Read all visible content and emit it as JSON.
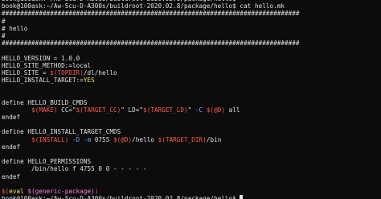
{
  "terminal": {
    "lines": [
      [
        {
          "t": "book@100ask:~/Aw-Scu-D-A300s/buildroot-2020.02.8/package/hello$",
          "c": "w"
        }
      ],
      [
        {
          "t": "book@100ask:~/Aw-Scu-D-A300s/buildroot-2020.02.8/package/hello$ cat hello.mk",
          "c": "w"
        }
      ],
      [
        {
          "t": "################################################################################",
          "c": "w"
        }
      ],
      [
        {
          "t": "#",
          "c": "w"
        }
      ],
      [
        {
          "t": "# hello",
          "c": "w"
        }
      ],
      [
        {
          "t": "#",
          "c": "w"
        }
      ],
      [
        {
          "t": "################################################################################",
          "c": "w"
        }
      ],
      [],
      [
        {
          "t": "HELLO_VERSION = 1.0.0",
          "c": "w"
        }
      ],
      [
        {
          "t": "HELLO_SITE_METHOD:=local",
          "c": "w"
        }
      ],
      [
        {
          "t": "HELLO_SITE = ",
          "c": "w"
        },
        {
          "t": "$(TOPDIR)",
          "c": "r"
        },
        {
          "t": "/dl/hello",
          "c": "w"
        }
      ],
      [
        {
          "t": "HELLO_INSTALL_TARGET:=",
          "c": "w"
        },
        {
          "t": "YES",
          "c": "y"
        }
      ],
      [],
      [],
      [
        {
          "t": "define HELLO_BUILD_CMDS",
          "c": "w"
        }
      ],
      [
        {
          "t": "        ",
          "c": "w"
        },
        {
          "t": "$(MAKE)",
          "c": "r"
        },
        {
          "t": " CC=\"",
          "c": "w"
        },
        {
          "t": "$(TARGET_CC)",
          "c": "r"
        },
        {
          "t": "\" LD=\"",
          "c": "w"
        },
        {
          "t": "$(TARGET_LD)",
          "c": "r"
        },
        {
          "t": "\" ",
          "c": "w"
        },
        {
          "t": "-C",
          "c": "b"
        },
        {
          "t": " ",
          "c": "w"
        },
        {
          "t": "$(@D)",
          "c": "r"
        },
        {
          "t": " all",
          "c": "w"
        }
      ],
      [
        {
          "t": "endef",
          "c": "w"
        }
      ],
      [],
      [
        {
          "t": "define HELLO_INSTALL_TARGET_CMDS",
          "c": "w"
        }
      ],
      [
        {
          "t": "        ",
          "c": "w"
        },
        {
          "t": "$(INSTALL)",
          "c": "r"
        },
        {
          "t": " ",
          "c": "w"
        },
        {
          "t": "-D",
          "c": "b"
        },
        {
          "t": " ",
          "c": "w"
        },
        {
          "t": "-m",
          "c": "b"
        },
        {
          "t": " 0755 ",
          "c": "w"
        },
        {
          "t": "$(@D)",
          "c": "r"
        },
        {
          "t": "/hello ",
          "c": "w"
        },
        {
          "t": "$(TARGET_DIR)",
          "c": "r"
        },
        {
          "t": "/bin",
          "c": "w"
        }
      ],
      [
        {
          "t": "endef",
          "c": "w"
        }
      ],
      [],
      [
        {
          "t": "define HELLO_PERMISSIONS",
          "c": "w"
        }
      ],
      [
        {
          "t": "        /bin/hello f 4755 0 0 - - - - -",
          "c": "w"
        }
      ],
      [
        {
          "t": "endef",
          "c": "w"
        }
      ],
      [],
      [
        {
          "t": "$(",
          "c": "r"
        },
        {
          "t": "eval",
          "c": "y"
        },
        {
          "t": " ",
          "c": "w"
        },
        {
          "t": "$(generic-package)",
          "c": "p"
        },
        {
          "t": ")",
          "c": "r"
        }
      ],
      [
        {
          "t": "book@100ask:~/Aw-Scu-D-A300s/buildroot-2020.02.8/package/hello$ ",
          "c": "w"
        }
      ]
    ]
  }
}
